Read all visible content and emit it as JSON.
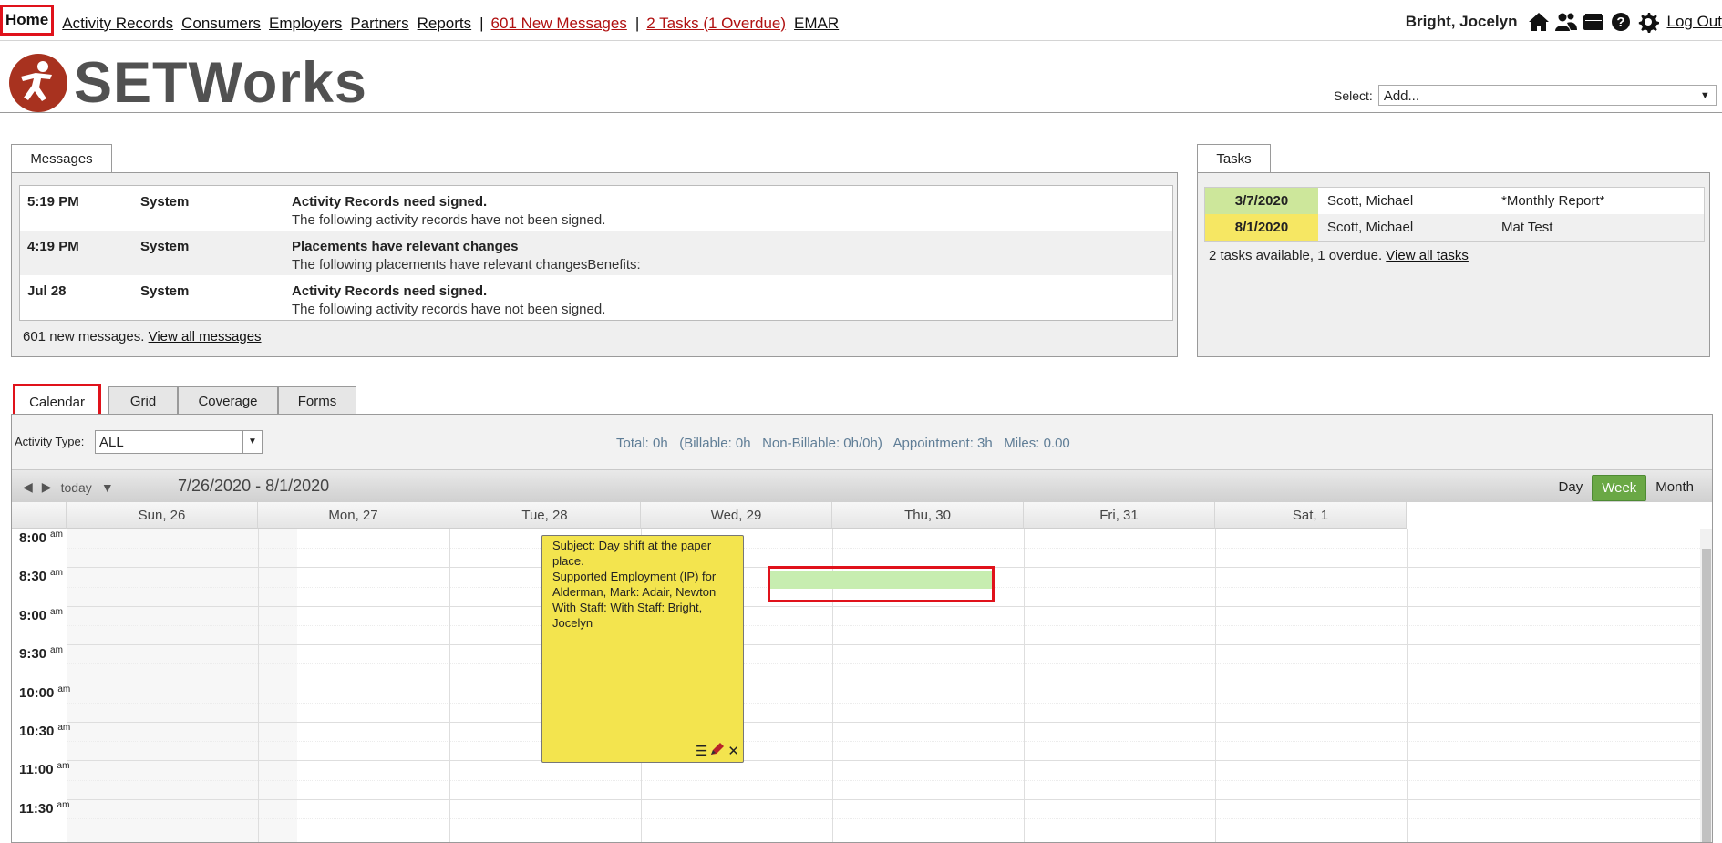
{
  "nav": {
    "home": "Home",
    "items": [
      "Activity Records",
      "Consumers",
      "Employers",
      "Partners",
      "Reports"
    ],
    "messages_link": "601 New Messages",
    "tasks_link": "2 Tasks (1 Overdue)",
    "emar": "EMAR",
    "user": "Bright, Jocelyn",
    "logout": "Log Out",
    "icons": [
      "home-icon",
      "people-icon",
      "folder-icon",
      "help-icon",
      "gear-icon"
    ]
  },
  "header": {
    "logo_text": "SETWorks",
    "select_label": "Select:",
    "select_value": "Add..."
  },
  "messages": {
    "tab": "Messages",
    "rows": [
      {
        "time": "5:19 PM",
        "sender": "System",
        "title": "Activity Records need signed.",
        "desc": "The following activity records have not been signed."
      },
      {
        "time": "4:19 PM",
        "sender": "System",
        "title": "Placements have relevant changes",
        "desc": "The following placements have relevant changesBenefits:"
      },
      {
        "time": "Jul 28",
        "sender": "System",
        "title": "Activity Records need signed.",
        "desc": "The following activity records have not been signed."
      }
    ],
    "summary": "601 new messages.",
    "view_all": "View all messages"
  },
  "tasks": {
    "tab": "Tasks",
    "rows": [
      {
        "date": "3/7/2020",
        "name": "Scott, Michael",
        "title": "*Monthly Report*",
        "color": "#cde79b"
      },
      {
        "date": "8/1/2020",
        "name": "Scott, Michael",
        "title": "Mat Test",
        "color": "#f6e763"
      }
    ],
    "summary": "2 tasks available, 1 overdue.",
    "view_all": "View all tasks"
  },
  "calendar": {
    "tabs": [
      "Calendar",
      "Grid",
      "Coverage",
      "Forms"
    ],
    "activity_type_label": "Activity Type:",
    "activity_type_value": "ALL",
    "stats": "Total: 0h   (Billable: 0h   Non-Billable: 0h/0h)   Appointment: 3h   Miles: 0.00",
    "today": "today",
    "range": "7/26/2020 - 8/1/2020",
    "views": [
      "Day",
      "Week",
      "Month"
    ],
    "active_view": "Week",
    "days": [
      "Sun, 26",
      "Mon, 27",
      "Tue, 28",
      "Wed, 29",
      "Thu, 30",
      "Fri, 31",
      "Sat, 1"
    ],
    "times": [
      {
        "t": "8:00",
        "p": "am"
      },
      {
        "t": "8:30",
        "p": "am"
      },
      {
        "t": "9:00",
        "p": "am"
      },
      {
        "t": "9:30",
        "p": "am"
      },
      {
        "t": "10:00",
        "p": "am"
      },
      {
        "t": "10:30",
        "p": "am"
      },
      {
        "t": "11:00",
        "p": "am"
      },
      {
        "t": "11:30",
        "p": "am"
      }
    ],
    "event": {
      "subject": "Subject: Day shift at the paper place.",
      "line2": "Supported Employment (IP) for Alderman, Mark: Adair, Newton",
      "line3": "With Staff: With Staff: Bright, Jocelyn"
    }
  }
}
